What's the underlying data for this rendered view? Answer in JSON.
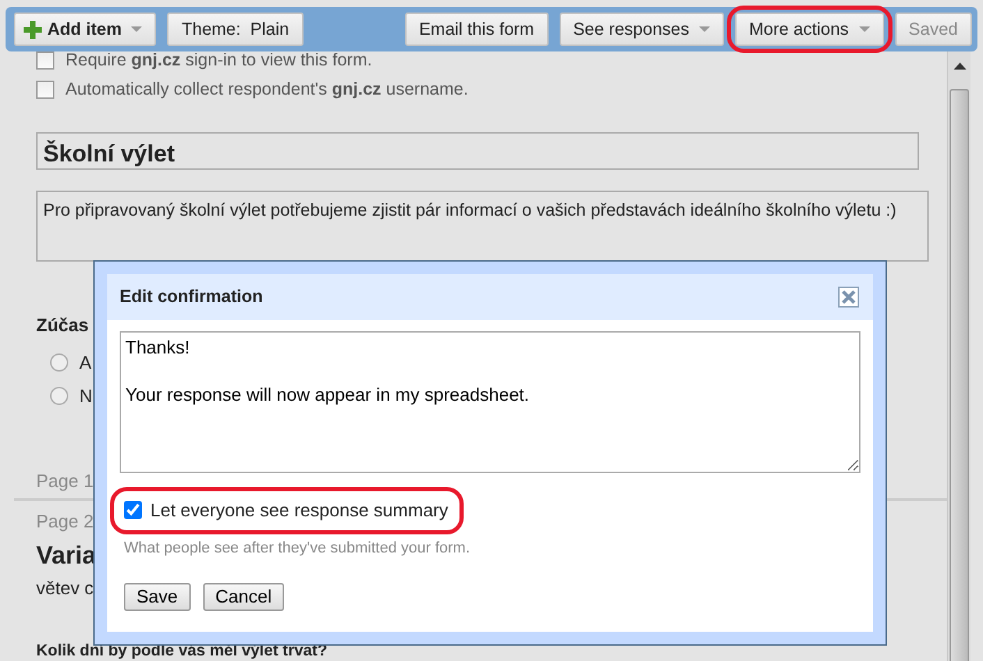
{
  "toolbar": {
    "left": [
      {
        "label": "Add item",
        "kind": "add",
        "dropdown": true,
        "disabled": false,
        "highlighted": false
      },
      {
        "label": "Theme:  Plain",
        "kind": "plain",
        "dropdown": false,
        "disabled": false,
        "highlighted": false
      }
    ],
    "right": [
      {
        "label": "Email this form",
        "kind": "plain",
        "dropdown": false,
        "disabled": false,
        "highlighted": false
      },
      {
        "label": "See responses",
        "kind": "plain",
        "dropdown": true,
        "disabled": false,
        "highlighted": false
      },
      {
        "label": "More actions",
        "kind": "plain",
        "dropdown": true,
        "disabled": false,
        "highlighted": true
      },
      {
        "label": "Saved",
        "kind": "plain",
        "dropdown": false,
        "disabled": true,
        "highlighted": false
      }
    ]
  },
  "settings": [
    {
      "label": "Require **gnj.cz** sign-in to view this form.",
      "checked": false
    },
    {
      "label": "Automatically collect respondent's **gnj.cz** username.",
      "checked": false
    }
  ],
  "form": {
    "title": "Školní výlet",
    "description": "Pro připravovaný školní výlet potřebujeme zjistit pár informací o vašich představách ideálního školního výletu :)",
    "question": {
      "title": "Zúčas",
      "options": [
        {
          "label": "A",
          "selected": false
        },
        {
          "label": "N",
          "selected": false
        }
      ]
    },
    "page_footer": "Page 1",
    "page2": {
      "label": "Page 2",
      "title": "Varia",
      "description": "větev c",
      "question": "Kolik dní by podle vás měl výlet trvat?"
    }
  },
  "dialog": {
    "title": "Edit confirmation",
    "message": "Thanks!\n\nYour response will now appear in my spreadsheet.",
    "checkbox": {
      "label": "Let everyone see response summary",
      "checked": true,
      "highlighted": true
    },
    "hint": "What people see after they've submitted your form.",
    "buttons": [
      "Save",
      "Cancel"
    ]
  }
}
